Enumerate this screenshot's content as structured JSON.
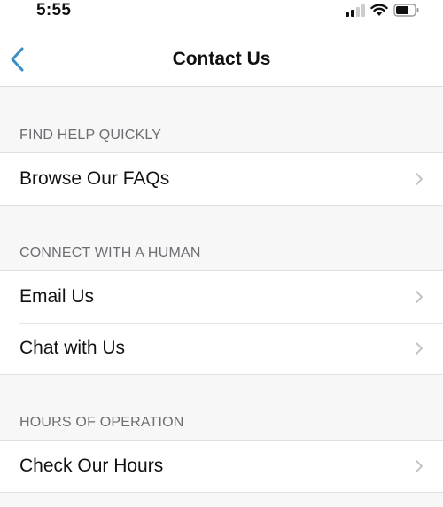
{
  "status_bar": {
    "time": "5:55",
    "icons": [
      "cellular-signal-icon",
      "wifi-icon",
      "battery-icon"
    ]
  },
  "nav": {
    "back_icon": "chevron-left-icon",
    "title": "Contact Us",
    "accent_color": "#3b8fc7"
  },
  "sections": [
    {
      "header": "FIND HELP QUICKLY",
      "items": [
        {
          "label": "Browse Our FAQs"
        }
      ]
    },
    {
      "header": "CONNECT WITH A HUMAN",
      "items": [
        {
          "label": "Email Us"
        },
        {
          "label": "Chat with Us"
        }
      ]
    },
    {
      "header": "HOURS OF OPERATION",
      "items": [
        {
          "label": "Check Our Hours"
        }
      ]
    }
  ]
}
